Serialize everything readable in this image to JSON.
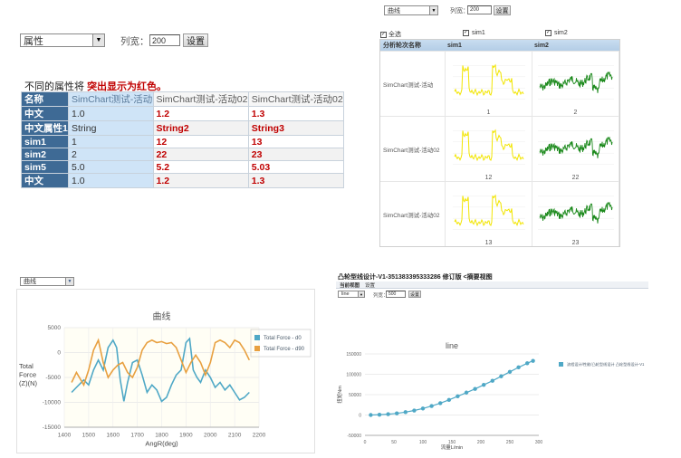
{
  "q1": {
    "select_value": "属性",
    "width_label": "列宽：",
    "width_value": "200",
    "set_button": "设置",
    "notice_prefix": "不同的属性将",
    "notice_highlight": "突出显示为红色。",
    "header_row": [
      "名称",
      "SimChart测试-活动",
      "SimChart测试-活动02",
      "SimChart测试-活动02"
    ],
    "rows": [
      {
        "label": "中文",
        "v": [
          "1.0",
          "1.2",
          "1.3"
        ],
        "diff": [
          false,
          true,
          true
        ]
      },
      {
        "label": "中文属性1",
        "v": [
          "String",
          "String2",
          "String3"
        ],
        "diff": [
          false,
          true,
          true
        ]
      },
      {
        "label": "sim1",
        "v": [
          "1",
          "12",
          "13"
        ],
        "diff": [
          false,
          true,
          true
        ]
      },
      {
        "label": "sim2",
        "v": [
          "2",
          "22",
          "23"
        ],
        "diff": [
          false,
          true,
          true
        ]
      },
      {
        "label": "sim5",
        "v": [
          "5.0",
          "5.2",
          "5.03"
        ],
        "diff": [
          false,
          true,
          true
        ]
      },
      {
        "label": "中文",
        "v": [
          "1.0",
          "1.2",
          "1.3"
        ],
        "diff": [
          false,
          true,
          true
        ]
      }
    ]
  },
  "q2": {
    "select_value": "曲线",
    "width_label": "列宽：",
    "width_value": "200",
    "set_button": "设置",
    "check_all": "全选",
    "check_sim1": "sim1",
    "check_sim2": "sim2",
    "col_name": "分析轮次名称",
    "col_sim1": "sim1",
    "col_sim2": "sim2",
    "rows": [
      {
        "name": "SimChart测试-活动",
        "sim1": "1",
        "sim2": "2"
      },
      {
        "name": "SimChart测试-活动02",
        "sim1": "12",
        "sim2": "22"
      },
      {
        "name": "SimChart测试-活动02",
        "sim1": "13",
        "sim2": "23"
      }
    ]
  },
  "q3": {
    "select_value": "曲线",
    "colors": {
      "d0": "#4fa8c6",
      "d90": "#e8a040"
    }
  },
  "q4": {
    "page_title": "凸轮型线设计-V1-351383395333286 修订版 <摘要视图",
    "tab_current": "当前视图",
    "tab_settings": "设置",
    "select_value": "line",
    "width_label": "列宽：",
    "width_value": "500",
    "set_button": "设置",
    "colors": {
      "series": "#4fa8c6"
    }
  },
  "chart_data": [
    {
      "type": "line",
      "title": "曲线",
      "xlabel": "AngR(deg)",
      "ylabel": "Total Force (Z)(N)",
      "xlim": [
        1400,
        2200
      ],
      "ylim": [
        -15000,
        5000
      ],
      "x_ticks": [
        1400,
        1500,
        1600,
        1700,
        1800,
        1900,
        2000,
        2100,
        2200
      ],
      "y_ticks": [
        5000,
        0,
        -5000,
        -10000,
        -15000
      ],
      "legend_position": "right",
      "series": [
        {
          "name": "Total Force - d0",
          "x": [
            1430,
            1450,
            1480,
            1500,
            1520,
            1540,
            1560,
            1580,
            1600,
            1615,
            1630,
            1645,
            1660,
            1680,
            1700,
            1720,
            1740,
            1760,
            1780,
            1800,
            1820,
            1840,
            1860,
            1880,
            1900,
            1915,
            1930,
            1945,
            1960,
            1980,
            2000,
            2020,
            2040,
            2060,
            2080,
            2100,
            2120,
            2140,
            2160
          ],
          "y": [
            -8000,
            -7000,
            -5500,
            -6500,
            -3500,
            -1500,
            -3500,
            1000,
            2500,
            1000,
            -5500,
            -9800,
            -6000,
            -2000,
            -1500,
            -4500,
            -8000,
            -6500,
            -7500,
            -9800,
            -9000,
            -6500,
            -4500,
            -3500,
            2000,
            2800,
            -3500,
            -5000,
            -6000,
            -3500,
            -5000,
            -7000,
            -6000,
            -7500,
            -6500,
            -8000,
            -9500,
            -9000,
            -8000
          ]
        },
        {
          "name": "Total Force - d90",
          "x": [
            1430,
            1450,
            1480,
            1500,
            1520,
            1540,
            1560,
            1580,
            1600,
            1620,
            1640,
            1660,
            1680,
            1700,
            1720,
            1740,
            1760,
            1780,
            1800,
            1820,
            1840,
            1860,
            1880,
            1900,
            1920,
            1940,
            1960,
            1980,
            2000,
            2020,
            2040,
            2060,
            2080,
            2100,
            2120,
            2140,
            2160
          ],
          "y": [
            -6000,
            -4000,
            -6500,
            -3500,
            500,
            2500,
            -2000,
            -5000,
            -3500,
            -2500,
            -2000,
            -4000,
            -5000,
            -3000,
            500,
            2000,
            2500,
            2000,
            2200,
            1800,
            2000,
            1000,
            -1500,
            -4000,
            -2000,
            -500,
            -2000,
            -4500,
            -2000,
            2000,
            2500,
            2000,
            1000,
            2500,
            2000,
            500,
            -1500
          ]
        }
      ]
    },
    {
      "type": "line",
      "title": "line",
      "xlabel": "流量L/min",
      "ylabel": "扭矩Nm",
      "xlim": [
        0,
        300
      ],
      "ylim": [
        -50000,
        150000
      ],
      "x_ticks": [
        0,
        50,
        100,
        150,
        200,
        250,
        300
      ],
      "y_ticks": [
        150000,
        100000,
        50000,
        0,
        -50000
      ],
      "legend_position": "right",
      "series": [
        {
          "name": "流程设计/性能/凸轮型线设计 凸轮型线设计-V1",
          "x": [
            10,
            25,
            40,
            55,
            70,
            85,
            100,
            115,
            130,
            145,
            160,
            175,
            190,
            205,
            220,
            235,
            250,
            265,
            280,
            290
          ],
          "y": [
            0,
            800,
            2000,
            4000,
            7000,
            11000,
            16000,
            22000,
            29000,
            37000,
            46000,
            55000,
            64000,
            74000,
            84000,
            95000,
            106000,
            117000,
            127000,
            133000
          ]
        }
      ]
    }
  ]
}
